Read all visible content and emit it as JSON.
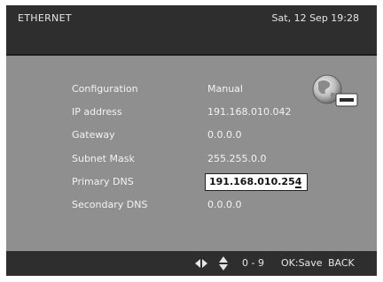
{
  "header": {
    "title": "ETHERNET",
    "datetime": "Sat, 12 Sep 19:28"
  },
  "rows": [
    {
      "label": "Configuration",
      "value": "Manual"
    },
    {
      "label": "IP address",
      "value": "191.168.010.042"
    },
    {
      "label": "Gateway",
      "value": "0.0.0.0"
    },
    {
      "label": "Subnet Mask",
      "value": "255.255.0.0"
    },
    {
      "label": "Primary DNS",
      "value": "191.168.010.25",
      "cursor_char": "4"
    },
    {
      "label": "Secondary DNS",
      "value": "0.0.0.0"
    }
  ],
  "footer": {
    "lr_icon": "left-right-arrow-icon",
    "ud_icon": "up-down-arrow-icon",
    "digits": "0 - 9",
    "ok": "OK:Save",
    "back": "BACK"
  },
  "colors": {
    "background": "#8f8f8f",
    "bar": "#2e2e2e",
    "text": "#f3f3f3"
  }
}
